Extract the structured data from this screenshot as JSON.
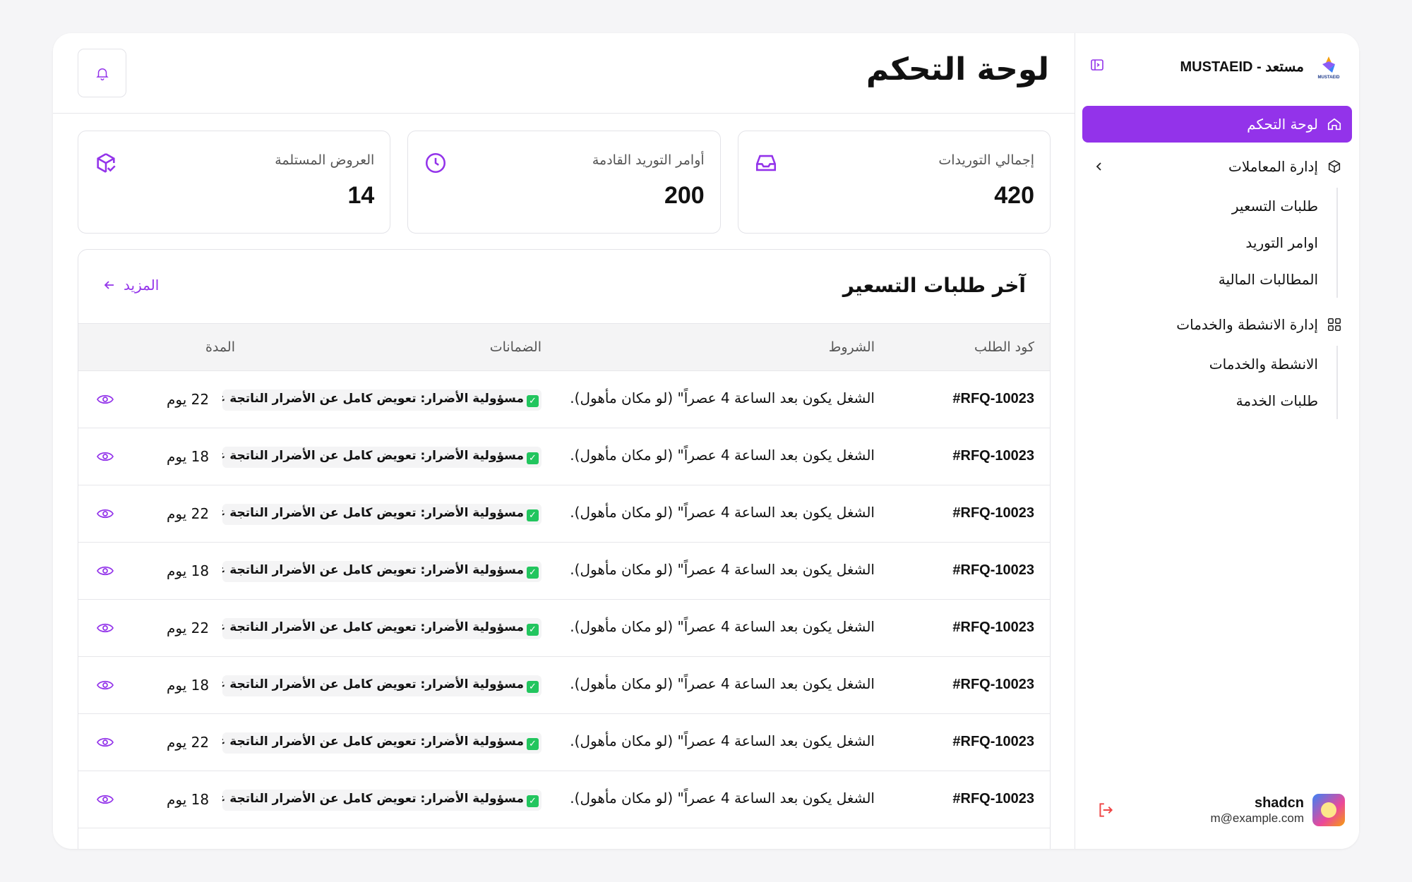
{
  "brand": {
    "name": "مستعد - MUSTAEID",
    "logo_text": "MUSTAEID"
  },
  "header": {
    "title": "لوحة التحكم"
  },
  "sidebar": {
    "active": {
      "label": "لوحة التحكم"
    },
    "groups": [
      {
        "label": "إدارة المعاملات",
        "items": [
          "طلبات التسعير",
          "اوامر التوريد",
          "المطالبات المالية"
        ]
      },
      {
        "label": "إدارة الانشطة والخدمات",
        "items": [
          "الانشطة والخدمات",
          "طلبات الخدمة"
        ]
      }
    ]
  },
  "user": {
    "name": "shadcn",
    "email": "m@example.com"
  },
  "stats": [
    {
      "label": "إجمالي التوريدات",
      "value": "420",
      "icon": "inbox-icon"
    },
    {
      "label": "أوامر التوريد القادمة",
      "value": "200",
      "icon": "clock-icon"
    },
    {
      "label": "العروض المستلمة",
      "value": "14",
      "icon": "package-check-icon"
    }
  ],
  "table": {
    "title": "آخر طلبات التسعير",
    "more_label": "المزيد",
    "columns": {
      "code": "كود الطلب",
      "terms": "الشروط",
      "guarantees": "الضمانات",
      "duration": "المدة"
    },
    "rows": [
      {
        "code": "#RFQ-10023",
        "terms": "الشغل يكون بعد الساعة 4 عصراً\" (لو مكان مأهول).",
        "guarantees": "مسؤولية الأضرار: تعويض كامل عن الأضرار الناتجة عن تقصير",
        "duration": "22 يوم"
      },
      {
        "code": "#RFQ-10023",
        "terms": "الشغل يكون بعد الساعة 4 عصراً\" (لو مكان مأهول).",
        "guarantees": "مسؤولية الأضرار: تعويض كامل عن الأضرار الناتجة عن تقصير",
        "duration": "18 يوم"
      },
      {
        "code": "#RFQ-10023",
        "terms": "الشغل يكون بعد الساعة 4 عصراً\" (لو مكان مأهول).",
        "guarantees": "مسؤولية الأضرار: تعويض كامل عن الأضرار الناتجة عن تقصير",
        "duration": "22 يوم"
      },
      {
        "code": "#RFQ-10023",
        "terms": "الشغل يكون بعد الساعة 4 عصراً\" (لو مكان مأهول).",
        "guarantees": "مسؤولية الأضرار: تعويض كامل عن الأضرار الناتجة عن تقصير",
        "duration": "18 يوم"
      },
      {
        "code": "#RFQ-10023",
        "terms": "الشغل يكون بعد الساعة 4 عصراً\" (لو مكان مأهول).",
        "guarantees": "مسؤولية الأضرار: تعويض كامل عن الأضرار الناتجة عن تقصير",
        "duration": "22 يوم"
      },
      {
        "code": "#RFQ-10023",
        "terms": "الشغل يكون بعد الساعة 4 عصراً\" (لو مكان مأهول).",
        "guarantees": "مسؤولية الأضرار: تعويض كامل عن الأضرار الناتجة عن تقصير",
        "duration": "18 يوم"
      },
      {
        "code": "#RFQ-10023",
        "terms": "الشغل يكون بعد الساعة 4 عصراً\" (لو مكان مأهول).",
        "guarantees": "مسؤولية الأضرار: تعويض كامل عن الأضرار الناتجة عن تقصير",
        "duration": "22 يوم"
      },
      {
        "code": "#RFQ-10023",
        "terms": "الشغل يكون بعد الساعة 4 عصراً\" (لو مكان مأهول).",
        "guarantees": "مسؤولية الأضرار: تعويض كامل عن الأضرار الناتجة عن تقصير",
        "duration": "18 يوم"
      }
    ]
  },
  "colors": {
    "accent": "#9333ea",
    "logout": "#ef4444",
    "check": "#22c55e"
  }
}
